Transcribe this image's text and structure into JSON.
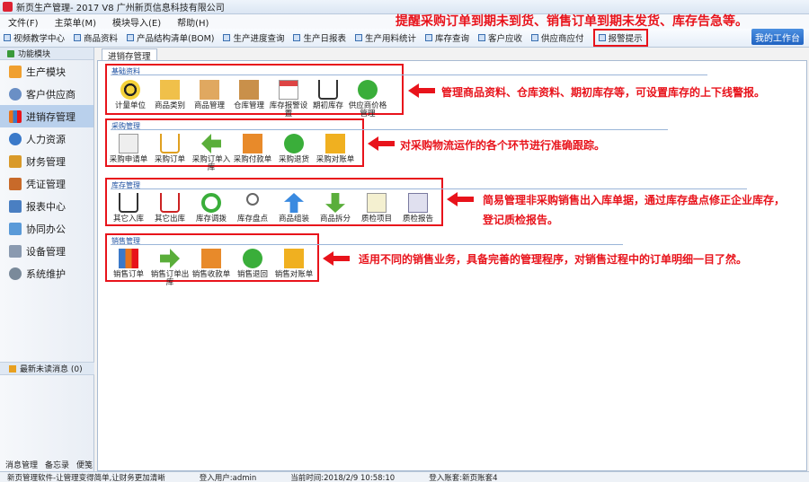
{
  "window": {
    "title": "新页生产管理- 2017 V8 广州新页信息科技有限公司"
  },
  "menu": [
    "文件(F)",
    "主菜单(M)",
    "模块导入(E)",
    "帮助(H)"
  ],
  "top_note": "提醒采购订单到期未到货、销售订单到期未发货、库存告急等。",
  "toolbar": [
    "视频教学中心",
    "商品资料",
    "产品结构清单(BOM)",
    "生产进度查询",
    "生产日报表",
    "生产用料统计",
    "库存查询",
    "客户应收",
    "供应商应付",
    "报警提示"
  ],
  "workspace_label": "我的工作台",
  "sidebar": {
    "header": "功能模块",
    "items": [
      "生产模块",
      "客户供应商",
      "进销存管理",
      "人力资源",
      "财务管理",
      "凭证管理",
      "报表中心",
      "协同办公",
      "设备管理",
      "系统维护"
    ],
    "unread": "最新未读消息 (0)",
    "bottom": [
      "消息管理",
      "备忘录",
      "便笺"
    ]
  },
  "tab_label": "进销存管理",
  "groups": [
    {
      "title": "基础资料",
      "note": "管理商品资料、仓库资料、期初库存等，可设置库存的上下线警报。",
      "modules": [
        "计量单位",
        "商品类别",
        "商品管理",
        "仓库管理",
        "库存报警设置",
        "期初库存",
        "供应商价格管理"
      ]
    },
    {
      "title": "采购管理",
      "note": "对采购物流运作的各个环节进行准确跟踪。",
      "modules": [
        "采购申请单",
        "采购订单",
        "采购订单入库",
        "采购付款单",
        "采购退货",
        "采购对账单"
      ]
    },
    {
      "title": "库存管理",
      "note": "简易管理非采购销售出入库单据，通过库存盘点修正企业库存，",
      "note2": "登记质检报告。",
      "modules": [
        "其它入库",
        "其它出库",
        "库存调拨",
        "库存盘点",
        "商品组装",
        "商品拆分",
        "质检项目",
        "质检报告"
      ]
    },
    {
      "title": "销售管理",
      "note": "适用不同的销售业务，具备完善的管理程序，对销售过程中的订单明细一目了然。",
      "modules": [
        "销售订单",
        "销售订单出库",
        "销售收款单",
        "销售退回",
        "销售对账单"
      ]
    }
  ],
  "status": [
    "新页管理软件-让管理变得简单,让财务更加清晰",
    "登入用户:admin",
    "当前时间:2018/2/9 10:58:10",
    "登入账套:新页账套4"
  ]
}
